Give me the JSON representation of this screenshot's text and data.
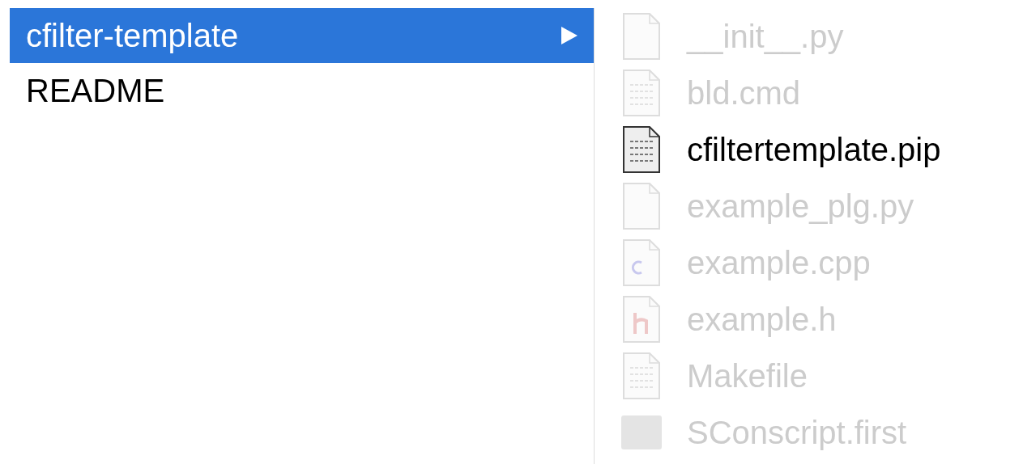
{
  "column_1": {
    "items": [
      {
        "name": "cfilter-template",
        "kind": "folder",
        "selected": true
      },
      {
        "name": "README",
        "kind": "file",
        "selected": false
      }
    ]
  },
  "column_2": {
    "items": [
      {
        "name": "__init__.py",
        "kind": "blank",
        "disabled": true
      },
      {
        "name": "bld.cmd",
        "kind": "text",
        "disabled": true
      },
      {
        "name": "cfiltertemplate.pip",
        "kind": "text",
        "disabled": false
      },
      {
        "name": "example_plg.py",
        "kind": "blank",
        "disabled": true
      },
      {
        "name": "example.cpp",
        "kind": "cpp",
        "disabled": true
      },
      {
        "name": "example.h",
        "kind": "header",
        "disabled": true
      },
      {
        "name": "Makefile",
        "kind": "text",
        "disabled": true
      },
      {
        "name": "SConscript.first",
        "kind": "block",
        "disabled": true
      }
    ]
  }
}
